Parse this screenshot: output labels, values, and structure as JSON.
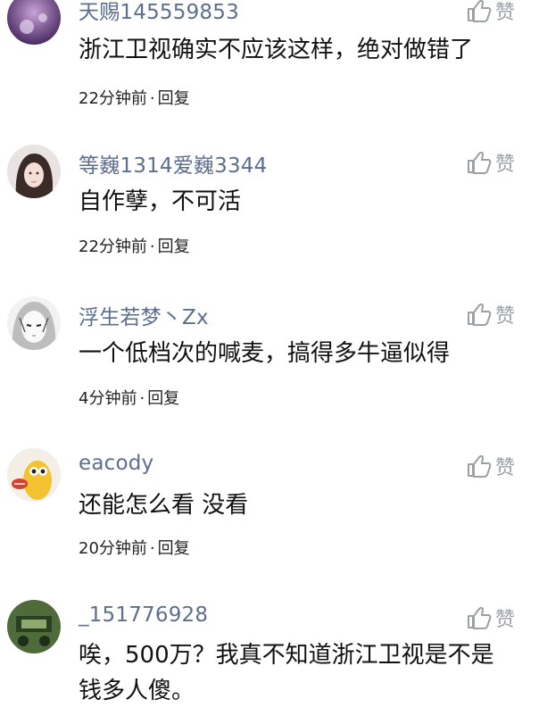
{
  "comments": [
    {
      "username": "天赐145559853",
      "text": "浙江卫视确实不应该这样，绝对做错了",
      "time": "22分钟前",
      "reply": "回复",
      "like": "赞",
      "avatar": "purple-scene-avatar"
    },
    {
      "username": "等巍1314爱巍3344",
      "text": "自作孽，不可活",
      "time": "22分钟前",
      "reply": "回复",
      "like": "赞",
      "avatar": "girl-portrait-avatar"
    },
    {
      "username": "浮生若梦丶Zx",
      "text": "一个低档次的喊麦，搞得多牛逼似得",
      "time": "4分钟前",
      "reply": "回复",
      "like": "赞",
      "avatar": "anime-sketch-avatar"
    },
    {
      "username": "eacody",
      "text": "还能怎么看 没看",
      "time": "20分钟前",
      "reply": "回复",
      "like": "赞",
      "avatar": "yellow-cartoon-avatar"
    },
    {
      "username": "_151776928",
      "text": "唉，500万？我真不知道浙江卫视是不是钱多人傻。",
      "time": "",
      "reply": "",
      "like": "赞",
      "avatar": "green-photo-avatar"
    }
  ],
  "colors": {
    "username": "#5d6f8e",
    "like_icon": "#9aa0a6"
  }
}
